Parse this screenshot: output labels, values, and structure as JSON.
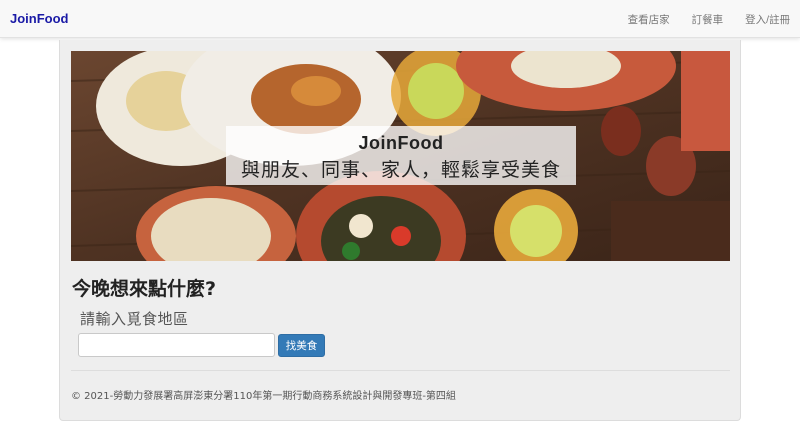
{
  "navbar": {
    "brand": "JoinFood",
    "links": [
      {
        "label": "查看店家"
      },
      {
        "label": "訂餐車"
      },
      {
        "label": "登入/註冊"
      }
    ]
  },
  "hero": {
    "title": "JoinFood",
    "subtitle": "與朋友、同事、家人，輕鬆享受美食"
  },
  "search": {
    "question": "今晚想來點什麼?",
    "label": "請輸入覓食地區",
    "value": "",
    "placeholder": "",
    "button_label": "找美食"
  },
  "footer": {
    "text": "© 2021-勞動力發展署高屏澎東分署110年第一期行動商務系統設計與開發專班-第四組"
  },
  "colors": {
    "brand": "#1a1aa6",
    "button": "#337ab7",
    "panel_background": "#eeeeee"
  }
}
